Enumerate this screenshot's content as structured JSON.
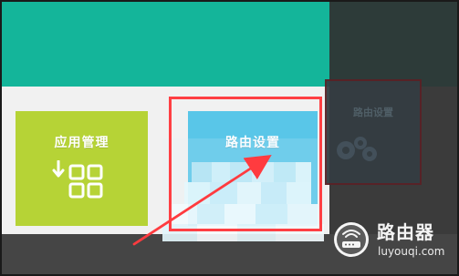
{
  "screen": {
    "theme_colors": {
      "teal": "#14b59a",
      "tile_app": "#b6d336",
      "tile_route": "#59c6e8",
      "highlight_red": "#ff3f43"
    }
  },
  "tiles": {
    "app_management": {
      "label": "应用管理",
      "icon": "app-grid-icon"
    },
    "route_settings": {
      "label": "路由设置"
    },
    "shadow_route_settings": {
      "label": "路由设置",
      "icon": "gear-icon"
    }
  },
  "annotation": {
    "selection": "route-settings-highlight",
    "pointer": "red-arrow"
  },
  "brand": {
    "name": "路由器",
    "url": "luyouqi.com"
  }
}
